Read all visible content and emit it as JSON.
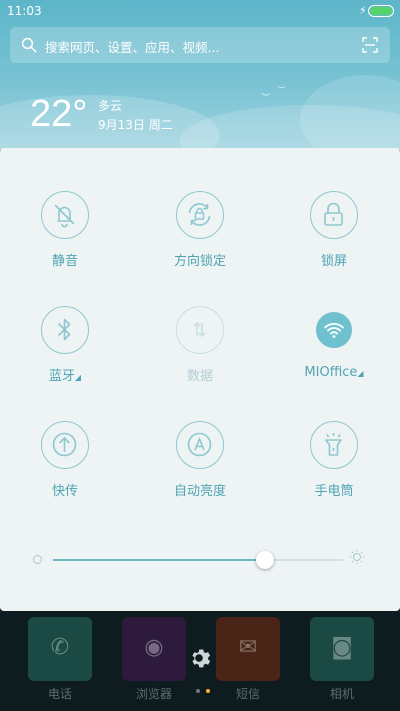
{
  "status": {
    "time": "11:03",
    "battery_level": 1.0
  },
  "search": {
    "placeholder": "搜索网页、设置、应用、视频..."
  },
  "weather": {
    "temperature": "22°",
    "condition": "多云",
    "date": "9月13日 周二"
  },
  "quick_settings": {
    "tiles": [
      {
        "id": "mute",
        "label": "静音",
        "icon": "bell-off-icon",
        "state": "off"
      },
      {
        "id": "rotation_lock",
        "label": "方向锁定",
        "icon": "rotation-lock-icon",
        "state": "off"
      },
      {
        "id": "lock_screen",
        "label": "锁屏",
        "icon": "lock-icon",
        "state": "off"
      },
      {
        "id": "bluetooth",
        "label": "蓝牙",
        "icon": "bluetooth-icon",
        "state": "off",
        "has_menu": true
      },
      {
        "id": "data",
        "label": "数据",
        "icon": "mobile-data-icon",
        "state": "disabled"
      },
      {
        "id": "wifi",
        "label": "MIOffice",
        "icon": "wifi-icon",
        "state": "on",
        "has_menu": true
      },
      {
        "id": "quick_transfer",
        "label": "快传",
        "icon": "upload-icon",
        "state": "off"
      },
      {
        "id": "auto_brightness",
        "label": "自动亮度",
        "icon": "auto-brightness-icon",
        "state": "off"
      },
      {
        "id": "flashlight",
        "label": "手电筒",
        "icon": "flashlight-icon",
        "state": "off"
      }
    ],
    "brightness": {
      "level": 0.73
    }
  },
  "dock": {
    "apps": [
      {
        "label": "电话",
        "icon": "phone-icon",
        "color": "#1b4a44"
      },
      {
        "label": "浏览器",
        "icon": "browser-icon",
        "color": "#2d1a3c"
      },
      {
        "label": "短信",
        "icon": "message-icon",
        "color": "#4a2416"
      },
      {
        "label": "相机",
        "icon": "camera-icon",
        "color": "#1b4a44"
      }
    ]
  },
  "colors": {
    "accent": "#4fa4b3",
    "panel_bg": "#eef3f4",
    "header_gradient_top": "#5db5c9",
    "page_indicator_active": "#f2b73a"
  }
}
